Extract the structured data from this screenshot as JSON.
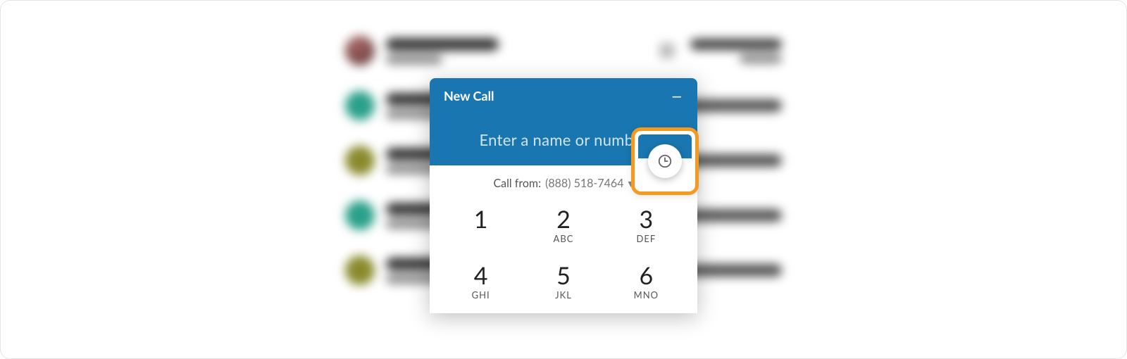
{
  "panel": {
    "title": "New Call",
    "minimize_label": "—",
    "input_placeholder": "Enter a name or number",
    "call_from_label": "Call from:",
    "call_from_number": "(888) 518-7464",
    "history_icon_name": "clock-icon"
  },
  "keypad": [
    {
      "digit": "1",
      "letters": ""
    },
    {
      "digit": "2",
      "letters": "ABC"
    },
    {
      "digit": "3",
      "letters": "DEF"
    },
    {
      "digit": "4",
      "letters": "GHI"
    },
    {
      "digit": "5",
      "letters": "JKL"
    },
    {
      "digit": "6",
      "letters": "MNO"
    }
  ],
  "colors": {
    "header_blue": "#1976b0",
    "highlight_orange": "#f39a1f"
  },
  "background_list": [
    {
      "name": "Girija Bhomawat",
      "sub": "Ext. 7648",
      "right_top": "Inbound call",
      "right_sub": "9 sec",
      "avatar": "photo"
    },
    {
      "name": "MYERS, A",
      "sub": "(817) 555-0100",
      "right_top": "Outbound call",
      "right_sub": "",
      "avatar": "teal"
    },
    {
      "name": "CHARIT",
      "sub": "(704) 555-0100",
      "right_top": "Outbound call",
      "right_sub": "",
      "avatar": "olive"
    },
    {
      "name": "MYERS, A",
      "sub": "(817) 555-0100",
      "right_top": "Outbound call",
      "right_sub": "",
      "avatar": "teal"
    },
    {
      "name": "CHARIT",
      "sub": "(704) 555-0100",
      "right_top": "Missed call",
      "right_sub": "",
      "avatar": "olive"
    }
  ]
}
